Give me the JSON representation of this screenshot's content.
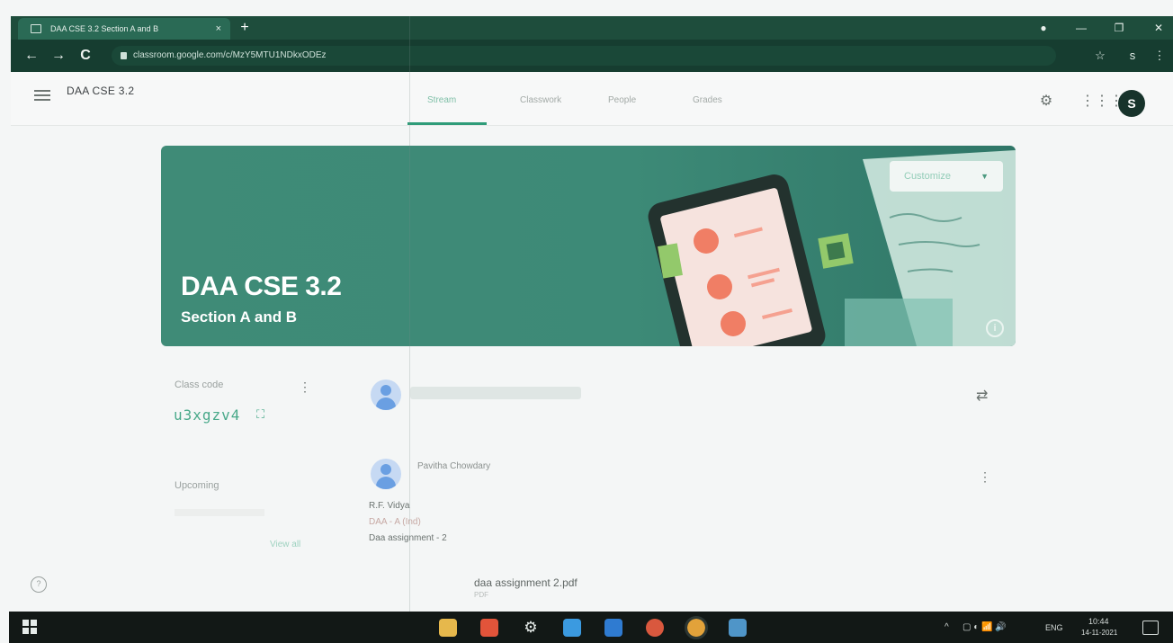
{
  "browser": {
    "tab_title": "DAA CSE 3.2 Section A and B",
    "tab_close": "×",
    "new_tab": "+",
    "url": "classroom.google.com/c/MzY5MTU1NDkxODEz",
    "nav": {
      "back": "←",
      "forward": "→",
      "reload": "C"
    },
    "window": {
      "minimize": "—",
      "restore": "❐",
      "close": "✕"
    },
    "star": "☆",
    "extension": "s",
    "menu": "⋮"
  },
  "header": {
    "course_name": "DAA CSE 3.2",
    "course_sub": "",
    "tabs": [
      {
        "label": "Stream",
        "active": true
      },
      {
        "label": "Classwork",
        "active": false
      },
      {
        "label": "People",
        "active": false
      },
      {
        "label": "Grades",
        "active": false
      }
    ],
    "avatar_letter": "S"
  },
  "banner": {
    "title": "DAA CSE 3.2",
    "subtitle": "Section A and B",
    "customize_label": "Customize",
    "info": "i",
    "color": "#3f8b77"
  },
  "class_code": {
    "label": "Class code",
    "value": "u3xgzv4"
  },
  "upcoming": {
    "label": "Upcoming",
    "view_all": "View all"
  },
  "stream": {
    "post": {
      "author": "Pavitha Chowdary",
      "lines": [
        "R.F. Vidya",
        "DAA - A (Ind)",
        "Daa assignment - 2"
      ],
      "attachment": "daa assignment 2.pdf"
    }
  },
  "taskbar": {
    "lang": "ENG",
    "time": "10:44",
    "date": "14-11-2021"
  },
  "colors": {
    "accent": "#2f9c79",
    "banner": "#3f8b77",
    "code_text": "#49a98a"
  }
}
